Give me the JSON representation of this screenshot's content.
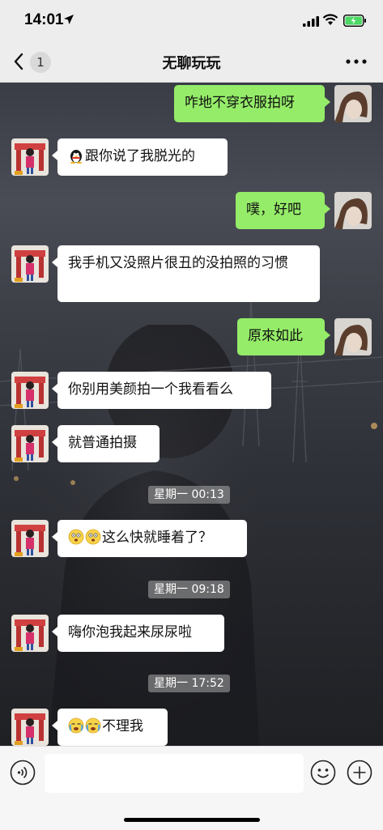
{
  "status_bar": {
    "time": "14:01"
  },
  "nav": {
    "back_badge": "1",
    "title": "无聊玩玩"
  },
  "messages": [
    {
      "side": "out",
      "text": "咋地不穿衣服拍呀"
    },
    {
      "side": "in",
      "emoji": "qq-penguin",
      "text": "跟你说了我脱光的"
    },
    {
      "side": "out",
      "text": "噗，好吧"
    },
    {
      "side": "in",
      "text": "我手机又没照片很丑的没拍照的习惯"
    },
    {
      "side": "out",
      "text": "原來如此"
    },
    {
      "side": "in",
      "text": "你别用美颜拍一个我看看么"
    },
    {
      "side": "in",
      "text": "就普通拍摄"
    },
    {
      "side": "in",
      "emoji": "shocked-face x2",
      "text": "这么快就睡着了？"
    },
    {
      "side": "in",
      "text": "嗨你泡我起来尿尿啦"
    },
    {
      "side": "in",
      "emoji": "crying-face x2",
      "text": "不理我"
    }
  ],
  "timestamps": [
    "星期一 00:13",
    "星期一 09:18",
    "星期一 17:52"
  ],
  "input": {
    "value": ""
  },
  "colors": {
    "outgoing_bubble": "#95ec69",
    "incoming_bubble": "#ffffff",
    "bar": "#ededed"
  }
}
